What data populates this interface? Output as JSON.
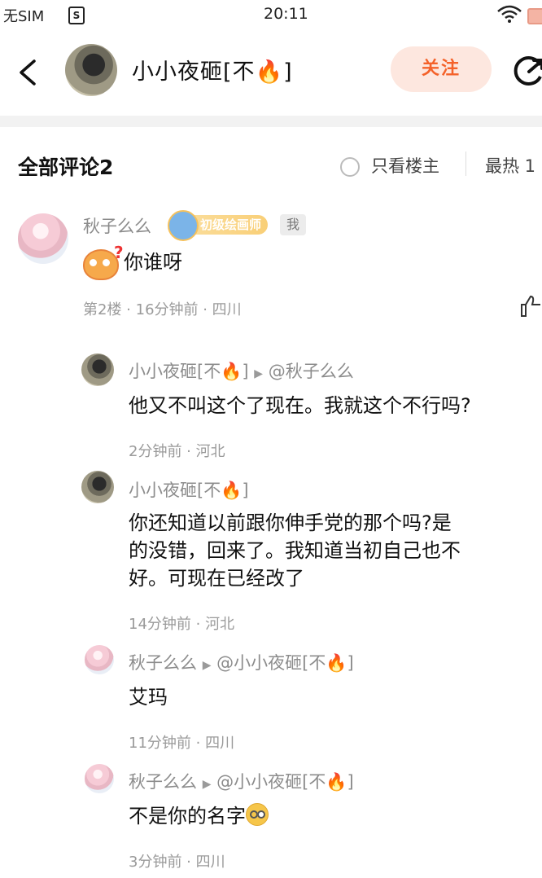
{
  "status_bar": {
    "carrier": "无SIM",
    "sim_icon": "S",
    "time": "20:11"
  },
  "header": {
    "title": "小小夜砸[不🔥]",
    "follow_label": "关注"
  },
  "filter_bar": {
    "comments_title": "全部评论2",
    "only_op_label": "只看楼主",
    "sort_label": "最热 1"
  },
  "main_comment": {
    "user": "秋子么么",
    "badge": "初级绘画师",
    "me_tag": "我",
    "text": "你谁呀",
    "meta": "第2楼 · 16分钟前 · 四川"
  },
  "replies": [
    {
      "user": "小小夜砸[不🔥]",
      "reply_to": "@秋子么么",
      "text": "他又不叫这个了现在。我就这个不行吗?",
      "meta": "2分钟前 · 河北"
    },
    {
      "user": "小小夜砸[不🔥]",
      "reply_to": "",
      "text_lines": [
        "你还知道以前跟你伸手党的那个吗?是",
        "的没错，回来了。我知道当初自己也不",
        "好。可现在已经改了"
      ],
      "meta": "14分钟前 · 河北"
    },
    {
      "user": "秋子么么",
      "reply_to": "@小小夜砸[不🔥]",
      "text": "艾玛",
      "meta": "11分钟前 · 四川"
    },
    {
      "user": "秋子么么",
      "reply_to": "@小小夜砸[不🔥]",
      "text": "不是你的名字",
      "meta": "3分钟前 · 四川"
    }
  ],
  "colors": {
    "accent": "#f4622a",
    "follow_bg": "#fde7df",
    "muted": "#9a9a9a"
  }
}
